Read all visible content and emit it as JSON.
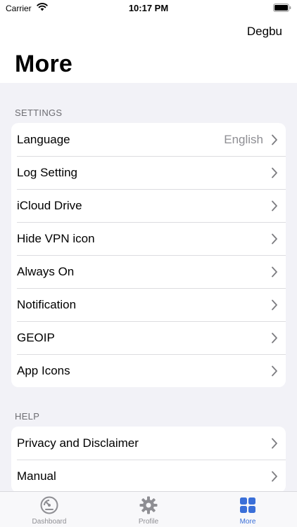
{
  "status_bar": {
    "carrier": "Carrier",
    "time": "10:17 PM"
  },
  "nav": {
    "right_action": "Degbu",
    "title": "More"
  },
  "settings": {
    "header": "SETTINGS",
    "items": [
      {
        "label": "Language",
        "value": "English"
      },
      {
        "label": "Log Setting"
      },
      {
        "label": "iCloud Drive"
      },
      {
        "label": "Hide VPN icon"
      },
      {
        "label": "Always On"
      },
      {
        "label": "Notification"
      },
      {
        "label": "GEOIP"
      },
      {
        "label": "App Icons"
      }
    ]
  },
  "help": {
    "header": "HELP",
    "items": [
      {
        "label": "Privacy and Disclaimer"
      },
      {
        "label": "Manual"
      }
    ]
  },
  "tabs": [
    {
      "label": "Dashboard",
      "icon": "dashboard-gauge-icon"
    },
    {
      "label": "Profile",
      "icon": "gear-icon"
    },
    {
      "label": "More",
      "icon": "grid-icon",
      "active": true
    }
  ],
  "colors": {
    "accent": "#3a6fd8",
    "background": "#f2f2f7",
    "secondary_text": "#8e8e93"
  }
}
